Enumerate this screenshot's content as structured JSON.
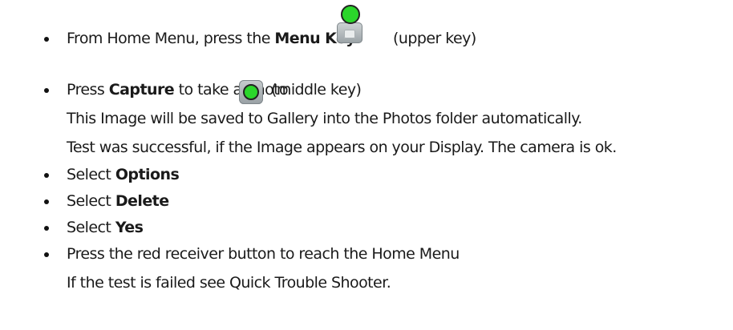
{
  "steps": [
    {
      "before": "From Home Menu, press the ",
      "bold": "Menu Key",
      "after": "(upper key)"
    },
    {
      "before": "Press ",
      "bold": "Capture",
      "after": " to take a photo",
      "hint": "(middle key)"
    },
    {
      "label": "Select ",
      "bold": "Options"
    },
    {
      "label": "Select ",
      "bold": "Delete"
    },
    {
      "label": "Select ",
      "bold": "Yes"
    },
    {
      "text": "Press the red receiver button to reach the Home Menu"
    }
  ],
  "notes": {
    "saved": "This Image will be saved to Gallery into the Photos folder automatically.",
    "success": "Test was successful, if the Image appears on your Display. The camera is ok.",
    "failed": "If the test is failed see Quick Trouble Shooter."
  },
  "icons": {
    "menu_key": "menu-key-icon",
    "capture_key": "capture-key-icon"
  }
}
